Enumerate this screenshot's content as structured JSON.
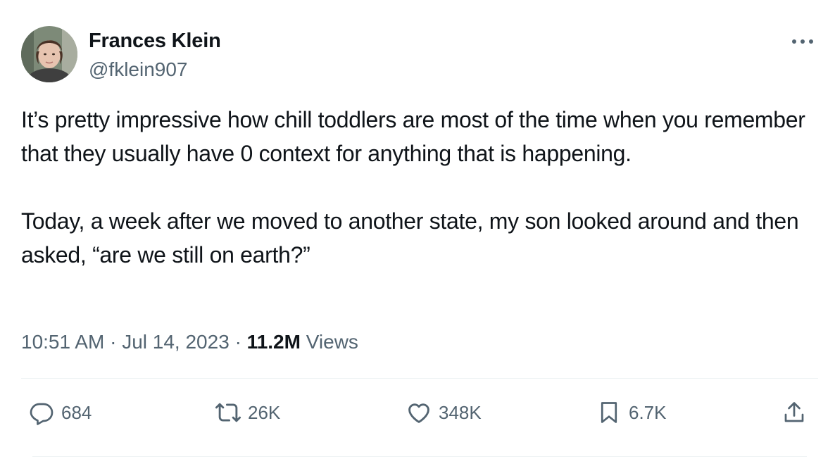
{
  "author": {
    "display_name": "Frances Klein",
    "handle": "@fklein907",
    "avatar_icon": "avatar-photo"
  },
  "more_icon": "more-horizontal-icon",
  "tweet": {
    "paragraphs": [
      "It’s pretty impressive how chill toddlers are most of the time when you remember that they usually have 0 context for anything that is happening.",
      "Today, a week after we moved to another state, my son looked around and then asked, “are we still on earth?”"
    ]
  },
  "meta": {
    "time": "10:51 AM",
    "separator": "·",
    "date": "Jul 14, 2023",
    "views_count": "11.2M",
    "views_label": "Views"
  },
  "actions": {
    "replies": "684",
    "retweets": "26K",
    "likes": "348K",
    "bookmarks": "6.7K"
  },
  "colors": {
    "text_primary": "#0f1419",
    "text_secondary": "#536471",
    "divider": "#eff3f4"
  }
}
